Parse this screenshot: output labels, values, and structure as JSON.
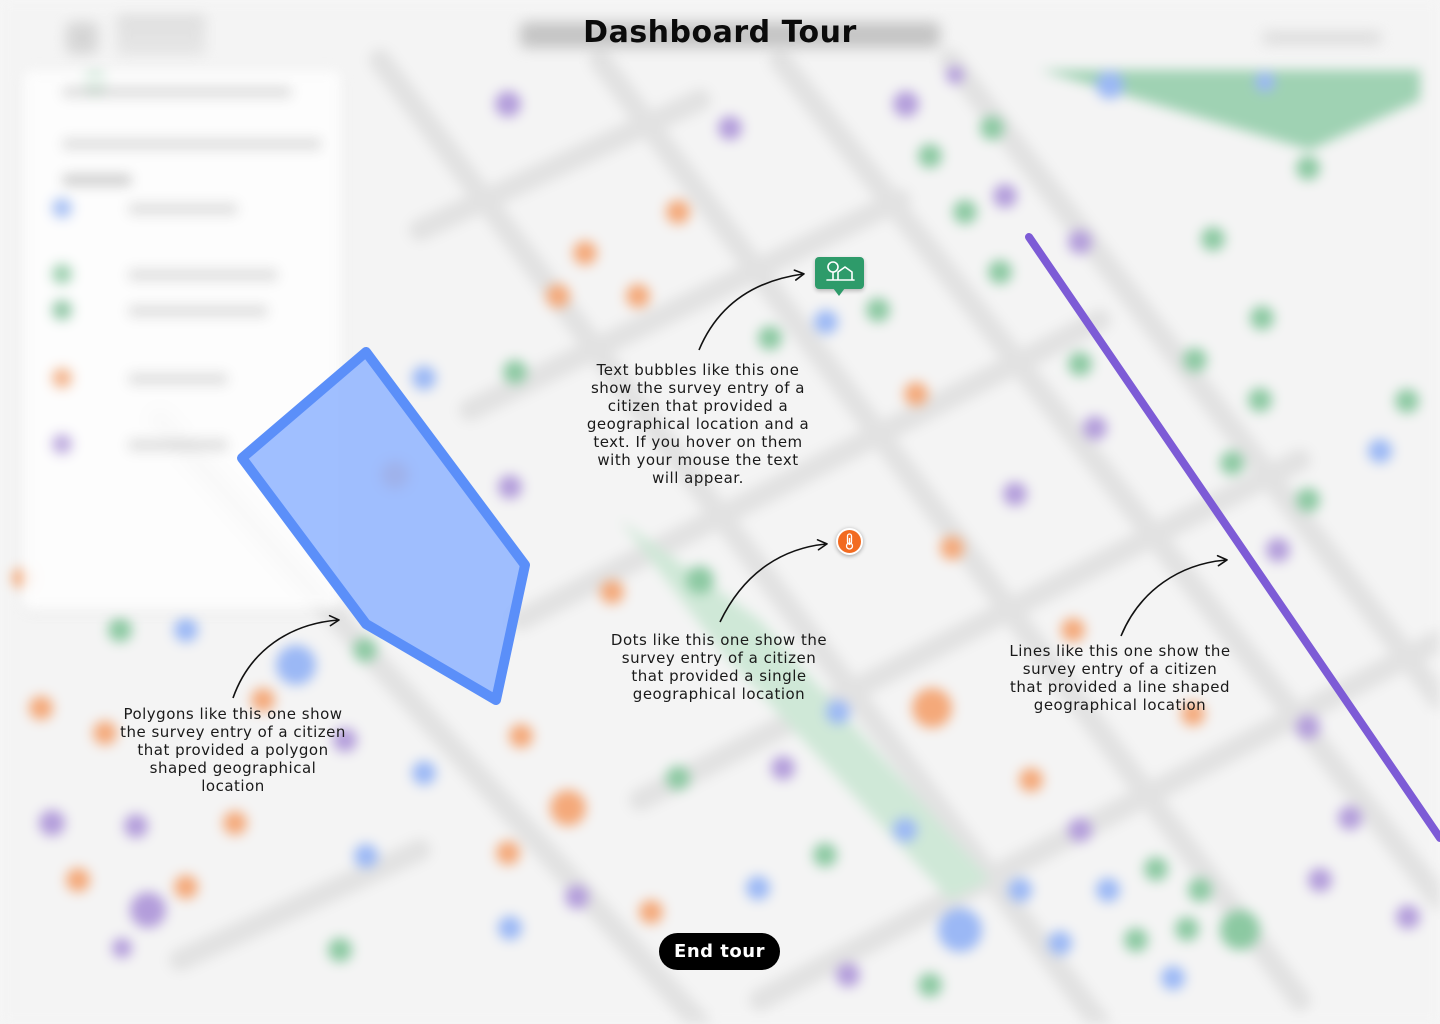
{
  "tour": {
    "title": "Dashboard Tour",
    "end_button_label": "End tour",
    "notes": {
      "text_bubble": "Text bubbles like this one show the survey entry of a citizen that provided a geographical location and a text. If you hover on them with your mouse the text will appear.",
      "dot": "Dots like this one show the survey entry of a citizen that provided a single geographical location",
      "line": "Lines like this one show the survey entry of a citizen that provided a line shaped geographical location",
      "polygon": "Polygons like this one show the survey entry of a citizen that provided a polygon shaped geographical location"
    }
  },
  "markers": {
    "text_bubble_icon": "map-location-icon",
    "dot_icon": "thermometer-icon"
  },
  "colors": {
    "polygon_fill": "#8fb4ff",
    "polygon_stroke": "#5b8ff9",
    "line_stroke": "#7d5bd6",
    "text_bubble_bg": "#2e9b6a",
    "dot_bg": "#f26b21",
    "button_bg": "#000000"
  }
}
